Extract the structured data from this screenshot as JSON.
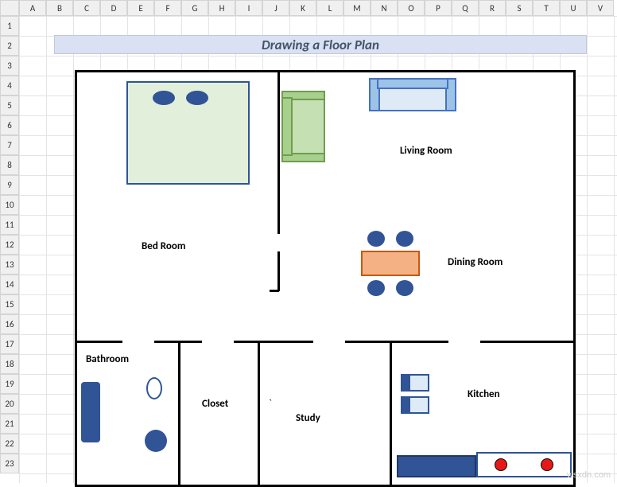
{
  "columns": [
    "A",
    "B",
    "C",
    "D",
    "E",
    "F",
    "G",
    "H",
    "I",
    "J",
    "K",
    "L",
    "M",
    "N",
    "O",
    "P",
    "Q",
    "R",
    "S",
    "T",
    "U",
    "V"
  ],
  "rows": [
    "1",
    "2",
    "3",
    "4",
    "5",
    "6",
    "7",
    "8",
    "9",
    "10",
    "11",
    "12",
    "13",
    "14",
    "15",
    "16",
    "17",
    "18",
    "19",
    "20",
    "21",
    "22",
    "23"
  ],
  "title": "Drawing a Floor Plan",
  "labels": {
    "bedroom": "Bed Room",
    "living": "Living Room",
    "dining": "Dining Room",
    "bathroom": "Bathroom",
    "closet": "Closet",
    "study": "Study",
    "kitchen": "Kitchen"
  },
  "stray": "`",
  "watermark": "wsxdn.com"
}
